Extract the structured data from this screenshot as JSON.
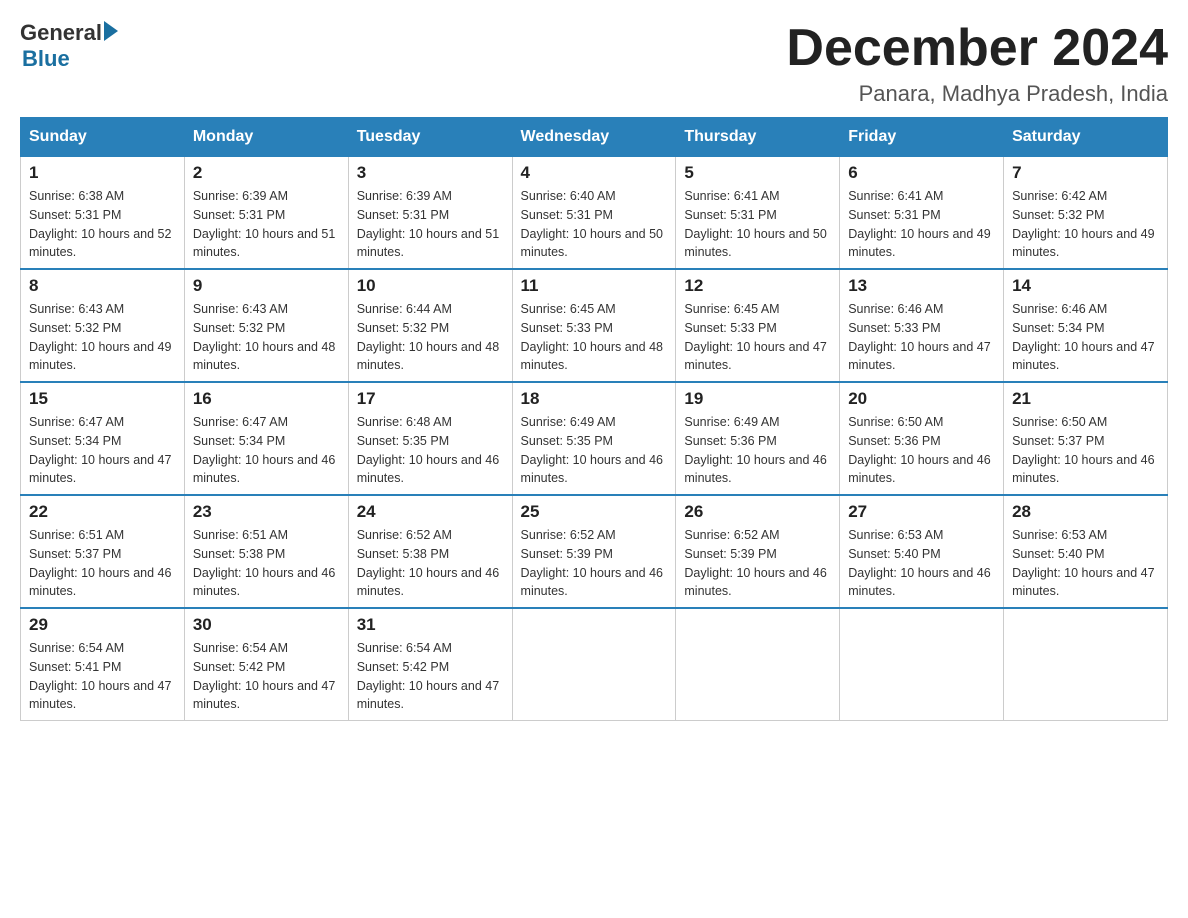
{
  "logo": {
    "general": "General",
    "arrow_color": "#1a6fa0",
    "blue": "Blue"
  },
  "header": {
    "title": "December 2024",
    "subtitle": "Panara, Madhya Pradesh, India"
  },
  "columns": [
    "Sunday",
    "Monday",
    "Tuesday",
    "Wednesday",
    "Thursday",
    "Friday",
    "Saturday"
  ],
  "weeks": [
    [
      {
        "day": "1",
        "sunrise": "6:38 AM",
        "sunset": "5:31 PM",
        "daylight": "10 hours and 52 minutes."
      },
      {
        "day": "2",
        "sunrise": "6:39 AM",
        "sunset": "5:31 PM",
        "daylight": "10 hours and 51 minutes."
      },
      {
        "day": "3",
        "sunrise": "6:39 AM",
        "sunset": "5:31 PM",
        "daylight": "10 hours and 51 minutes."
      },
      {
        "day": "4",
        "sunrise": "6:40 AM",
        "sunset": "5:31 PM",
        "daylight": "10 hours and 50 minutes."
      },
      {
        "day": "5",
        "sunrise": "6:41 AM",
        "sunset": "5:31 PM",
        "daylight": "10 hours and 50 minutes."
      },
      {
        "day": "6",
        "sunrise": "6:41 AM",
        "sunset": "5:31 PM",
        "daylight": "10 hours and 49 minutes."
      },
      {
        "day": "7",
        "sunrise": "6:42 AM",
        "sunset": "5:32 PM",
        "daylight": "10 hours and 49 minutes."
      }
    ],
    [
      {
        "day": "8",
        "sunrise": "6:43 AM",
        "sunset": "5:32 PM",
        "daylight": "10 hours and 49 minutes."
      },
      {
        "day": "9",
        "sunrise": "6:43 AM",
        "sunset": "5:32 PM",
        "daylight": "10 hours and 48 minutes."
      },
      {
        "day": "10",
        "sunrise": "6:44 AM",
        "sunset": "5:32 PM",
        "daylight": "10 hours and 48 minutes."
      },
      {
        "day": "11",
        "sunrise": "6:45 AM",
        "sunset": "5:33 PM",
        "daylight": "10 hours and 48 minutes."
      },
      {
        "day": "12",
        "sunrise": "6:45 AM",
        "sunset": "5:33 PM",
        "daylight": "10 hours and 47 minutes."
      },
      {
        "day": "13",
        "sunrise": "6:46 AM",
        "sunset": "5:33 PM",
        "daylight": "10 hours and 47 minutes."
      },
      {
        "day": "14",
        "sunrise": "6:46 AM",
        "sunset": "5:34 PM",
        "daylight": "10 hours and 47 minutes."
      }
    ],
    [
      {
        "day": "15",
        "sunrise": "6:47 AM",
        "sunset": "5:34 PM",
        "daylight": "10 hours and 47 minutes."
      },
      {
        "day": "16",
        "sunrise": "6:47 AM",
        "sunset": "5:34 PM",
        "daylight": "10 hours and 46 minutes."
      },
      {
        "day": "17",
        "sunrise": "6:48 AM",
        "sunset": "5:35 PM",
        "daylight": "10 hours and 46 minutes."
      },
      {
        "day": "18",
        "sunrise": "6:49 AM",
        "sunset": "5:35 PM",
        "daylight": "10 hours and 46 minutes."
      },
      {
        "day": "19",
        "sunrise": "6:49 AM",
        "sunset": "5:36 PM",
        "daylight": "10 hours and 46 minutes."
      },
      {
        "day": "20",
        "sunrise": "6:50 AM",
        "sunset": "5:36 PM",
        "daylight": "10 hours and 46 minutes."
      },
      {
        "day": "21",
        "sunrise": "6:50 AM",
        "sunset": "5:37 PM",
        "daylight": "10 hours and 46 minutes."
      }
    ],
    [
      {
        "day": "22",
        "sunrise": "6:51 AM",
        "sunset": "5:37 PM",
        "daylight": "10 hours and 46 minutes."
      },
      {
        "day": "23",
        "sunrise": "6:51 AM",
        "sunset": "5:38 PM",
        "daylight": "10 hours and 46 minutes."
      },
      {
        "day": "24",
        "sunrise": "6:52 AM",
        "sunset": "5:38 PM",
        "daylight": "10 hours and 46 minutes."
      },
      {
        "day": "25",
        "sunrise": "6:52 AM",
        "sunset": "5:39 PM",
        "daylight": "10 hours and 46 minutes."
      },
      {
        "day": "26",
        "sunrise": "6:52 AM",
        "sunset": "5:39 PM",
        "daylight": "10 hours and 46 minutes."
      },
      {
        "day": "27",
        "sunrise": "6:53 AM",
        "sunset": "5:40 PM",
        "daylight": "10 hours and 46 minutes."
      },
      {
        "day": "28",
        "sunrise": "6:53 AM",
        "sunset": "5:40 PM",
        "daylight": "10 hours and 47 minutes."
      }
    ],
    [
      {
        "day": "29",
        "sunrise": "6:54 AM",
        "sunset": "5:41 PM",
        "daylight": "10 hours and 47 minutes."
      },
      {
        "day": "30",
        "sunrise": "6:54 AM",
        "sunset": "5:42 PM",
        "daylight": "10 hours and 47 minutes."
      },
      {
        "day": "31",
        "sunrise": "6:54 AM",
        "sunset": "5:42 PM",
        "daylight": "10 hours and 47 minutes."
      },
      null,
      null,
      null,
      null
    ]
  ]
}
